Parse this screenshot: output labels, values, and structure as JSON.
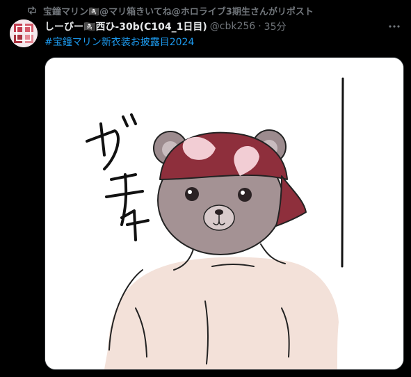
{
  "repost": {
    "reposter": "宝鐘マリン🏴‍☠️@マリ箱きいてね@ホロライブ3期生さん",
    "suffix": "がリポスト",
    "icon": "repost-icon"
  },
  "tweet": {
    "display_name": "しーびー🏴‍☠️西ひ-30b(C104_1日目)",
    "handle": "@cbk256",
    "separator": "·",
    "time": "35分",
    "hashtag": "#宝鐘マリン新衣装お披露目2024",
    "more_icon": "more-icon"
  },
  "colors": {
    "background": "#000000",
    "secondary_text": "#71767b",
    "link": "#1d9bf0"
  }
}
